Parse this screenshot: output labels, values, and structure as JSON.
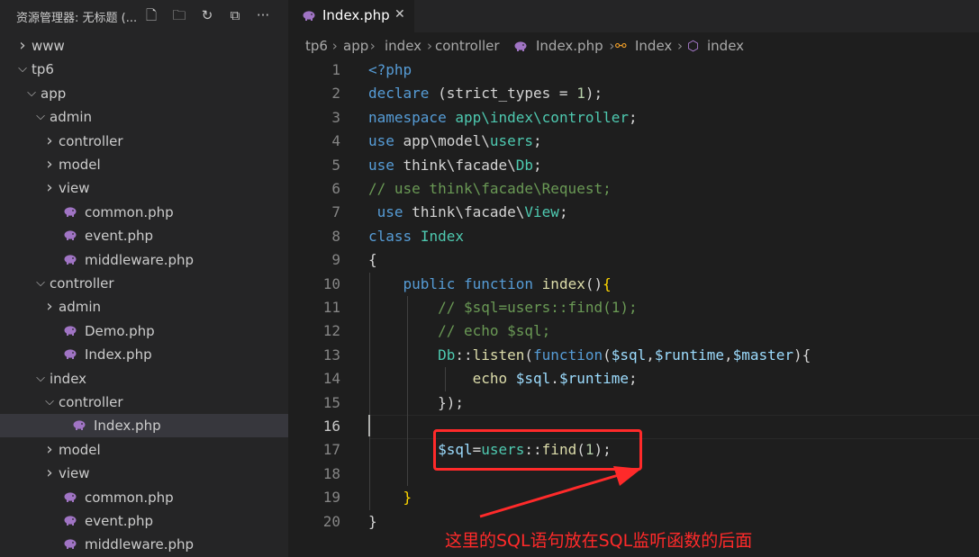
{
  "sidebar": {
    "title": "资源管理器: 无标题 (...",
    "actions": [
      "new-file-icon",
      "new-folder-icon",
      "refresh-icon",
      "collapse-all-icon",
      "more-icon"
    ],
    "tree": [
      {
        "label": "www",
        "type": "folder",
        "expanded": false,
        "depth": 0
      },
      {
        "label": "tp6",
        "type": "folder",
        "expanded": true,
        "depth": 0
      },
      {
        "label": "app",
        "type": "folder",
        "expanded": true,
        "depth": 1
      },
      {
        "label": "admin",
        "type": "folder",
        "expanded": true,
        "depth": 2
      },
      {
        "label": "controller",
        "type": "folder",
        "expanded": false,
        "depth": 3
      },
      {
        "label": "model",
        "type": "folder",
        "expanded": false,
        "depth": 3
      },
      {
        "label": "view",
        "type": "folder",
        "expanded": false,
        "depth": 3
      },
      {
        "label": "common.php",
        "type": "php",
        "depth": 3
      },
      {
        "label": "event.php",
        "type": "php",
        "depth": 3
      },
      {
        "label": "middleware.php",
        "type": "php",
        "depth": 3
      },
      {
        "label": "controller",
        "type": "folder",
        "expanded": true,
        "depth": 2
      },
      {
        "label": "admin",
        "type": "folder",
        "expanded": false,
        "depth": 3
      },
      {
        "label": "Demo.php",
        "type": "php",
        "depth": 3
      },
      {
        "label": "Index.php",
        "type": "php",
        "depth": 3
      },
      {
        "label": "index",
        "type": "folder",
        "expanded": true,
        "depth": 2
      },
      {
        "label": "controller",
        "type": "folder",
        "expanded": true,
        "depth": 3
      },
      {
        "label": "Index.php",
        "type": "php",
        "depth": 4,
        "selected": true
      },
      {
        "label": "model",
        "type": "folder",
        "expanded": false,
        "depth": 3
      },
      {
        "label": "view",
        "type": "folder",
        "expanded": false,
        "depth": 3
      },
      {
        "label": "common.php",
        "type": "php",
        "depth": 3
      },
      {
        "label": "event.php",
        "type": "php",
        "depth": 3
      },
      {
        "label": "middleware.php",
        "type": "php",
        "depth": 3
      }
    ]
  },
  "tab": {
    "label": "Index.php",
    "close": "✕"
  },
  "breadcrumb": [
    "tp6",
    "app",
    "index",
    "controller",
    "Index.php",
    "Index",
    "index"
  ],
  "code": {
    "active_line": 16,
    "lines": [
      [
        [
          "kw",
          "<?php"
        ]
      ],
      [
        [
          "kw",
          "declare"
        ],
        [
          "tx",
          " (strict_types = "
        ],
        [
          "nm",
          "1"
        ],
        [
          "tx",
          ");"
        ]
      ],
      [
        [
          "kw",
          "namespace"
        ],
        [
          "tx",
          " "
        ],
        [
          "ns",
          "app\\index\\controller"
        ],
        [
          "tx",
          ";"
        ]
      ],
      [
        [
          "kw",
          "use"
        ],
        [
          "tx",
          " app\\model\\"
        ],
        [
          "ns",
          "users"
        ],
        [
          "tx",
          ";"
        ]
      ],
      [
        [
          "kw",
          "use"
        ],
        [
          "tx",
          " think\\facade\\"
        ],
        [
          "ns",
          "Db"
        ],
        [
          "tx",
          ";"
        ]
      ],
      [
        [
          "cm",
          "// use think\\facade\\Request;"
        ]
      ],
      [
        [
          "tx",
          " "
        ],
        [
          "kw",
          "use"
        ],
        [
          "tx",
          " think\\facade\\"
        ],
        [
          "ns",
          "View"
        ],
        [
          "tx",
          ";"
        ]
      ],
      [
        [
          "kw",
          "class"
        ],
        [
          "tx",
          " "
        ],
        [
          "ns",
          "Index"
        ]
      ],
      [
        [
          "tx",
          "{"
        ]
      ],
      [
        [
          "tx",
          "    "
        ],
        [
          "kw",
          "public"
        ],
        [
          "tx",
          " "
        ],
        [
          "kw",
          "function"
        ],
        [
          "tx",
          " "
        ],
        [
          "fn",
          "index"
        ],
        [
          "tx",
          "()"
        ],
        [
          "hl",
          "{"
        ]
      ],
      [
        [
          "tx",
          "        "
        ],
        [
          "cm",
          "// $sql=users::find(1);"
        ]
      ],
      [
        [
          "tx",
          "        "
        ],
        [
          "cm",
          "// echo $sql;"
        ]
      ],
      [
        [
          "tx",
          "        "
        ],
        [
          "ns",
          "Db"
        ],
        [
          "tx",
          "::"
        ],
        [
          "fn",
          "listen"
        ],
        [
          "tx",
          "("
        ],
        [
          "kw",
          "function"
        ],
        [
          "tx",
          "("
        ],
        [
          "vr",
          "$sql"
        ],
        [
          "tx",
          ","
        ],
        [
          "vr",
          "$runtime"
        ],
        [
          "tx",
          ","
        ],
        [
          "vr",
          "$master"
        ],
        [
          "tx",
          "){"
        ]
      ],
      [
        [
          "tx",
          "            "
        ],
        [
          "fn",
          "echo"
        ],
        [
          "tx",
          " "
        ],
        [
          "vr",
          "$sql"
        ],
        [
          "tx",
          "."
        ],
        [
          "vr",
          "$runtime"
        ],
        [
          "tx",
          ";"
        ]
      ],
      [
        [
          "tx",
          "        });"
        ]
      ],
      [
        [
          "tx",
          ""
        ]
      ],
      [
        [
          "tx",
          "        "
        ],
        [
          "vr",
          "$sql"
        ],
        [
          "tx",
          "="
        ],
        [
          "ns",
          "users"
        ],
        [
          "tx",
          "::"
        ],
        [
          "fn",
          "find"
        ],
        [
          "tx",
          "("
        ],
        [
          "nm",
          "1"
        ],
        [
          "tx",
          ");"
        ]
      ],
      [
        [
          "tx",
          ""
        ]
      ],
      [
        [
          "tx",
          "    "
        ],
        [
          "hl",
          "}"
        ]
      ],
      [
        [
          "tx",
          "}"
        ]
      ]
    ]
  },
  "annotation": {
    "text": "这里的SQL语句放在SQL监听函数的后面",
    "color": "#ff2a2a"
  },
  "colors": {
    "keyword": "#569cd6",
    "type": "#4ec9b0",
    "function": "#dcdcaa",
    "variable": "#9cdcfe",
    "number": "#b5cea8",
    "comment": "#6a9955",
    "bracket": "#ffd700",
    "php_icon": "#a074c4"
  }
}
